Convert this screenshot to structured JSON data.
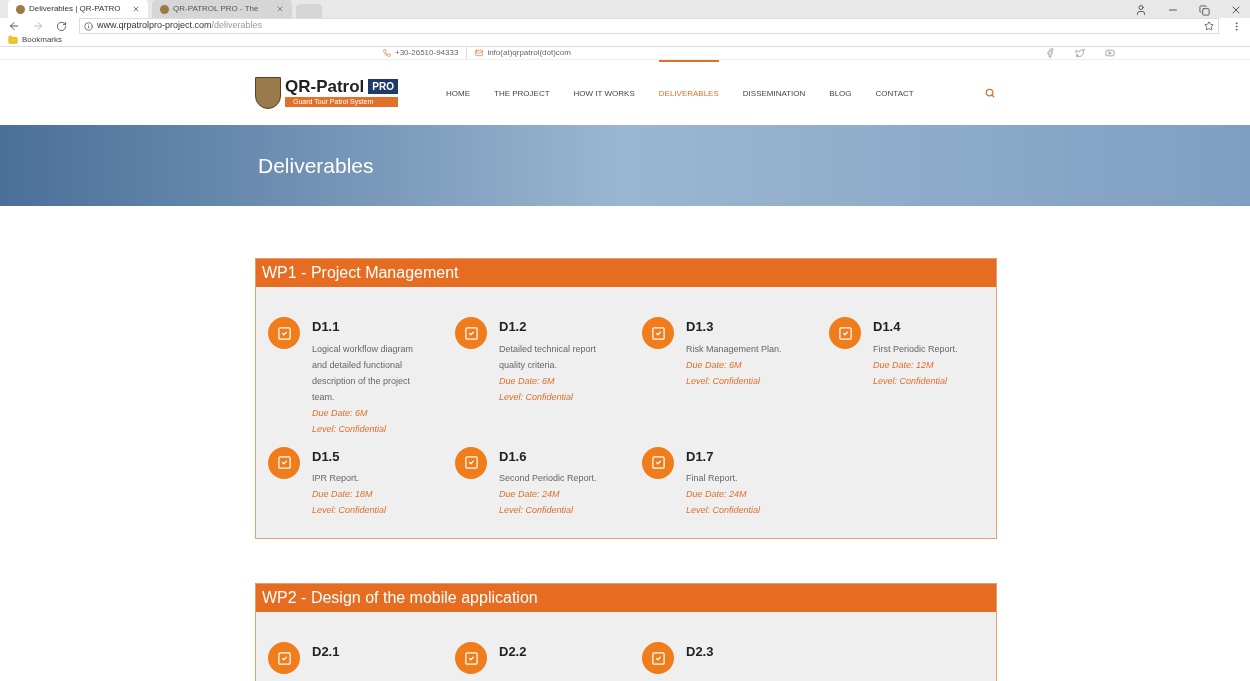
{
  "browser": {
    "tabs": [
      {
        "title": "Deliverables | QR-PATRO",
        "selected": true
      },
      {
        "title": "QR-PATROL PRO - The",
        "selected": false
      }
    ],
    "url_host": "www.qrpatrolpro-project.com",
    "url_path": "/deliverables",
    "bookmarks": "Bookmarks"
  },
  "topbar": {
    "phone": "+30-26510-94333",
    "email": "info(at)qrpatrol(dot)com"
  },
  "logo": {
    "name": "QR-Patrol",
    "badge": "PRO",
    "tagline": "Guard Tour Patrol System"
  },
  "nav": [
    {
      "label": "HOME",
      "selected": false
    },
    {
      "label": "THE PROJECT",
      "selected": false
    },
    {
      "label": "HOW IT WORKS",
      "selected": false
    },
    {
      "label": "DELIVERABLES",
      "selected": true
    },
    {
      "label": "DISSEMINATION",
      "selected": false
    },
    {
      "label": "BLOG",
      "selected": false
    },
    {
      "label": "CONTACT",
      "selected": false
    }
  ],
  "banner": {
    "title": "Deliverables"
  },
  "work_packages": [
    {
      "title": "WP1 - Project Management",
      "items": [
        {
          "code": "D1.1",
          "description": "Logical workflow diagram and detailed functional description of the project team.",
          "due": "Due Date: 6M",
          "level": "Level: Confidential"
        },
        {
          "code": "D1.2",
          "description": "Detailed technical report quality criteria.",
          "due": "Due Date: 6M",
          "level": "Level: Confidential"
        },
        {
          "code": "D1.3",
          "description": "Risk Management Plan.",
          "due": "Due Date: 6M",
          "level": "Level: Confidential"
        },
        {
          "code": "D1.4",
          "description": "First Periodic Report.",
          "due": "Due Date: 12M",
          "level": "Level: Confidential"
        },
        {
          "code": "D1.5",
          "description": "IPR Report.",
          "due": "Due Date: 18M",
          "level": "Level: Confidential"
        },
        {
          "code": "D1.6",
          "description": "Second Periodic Report.",
          "due": "Due Date: 24M",
          "level": "Level: Confidential"
        },
        {
          "code": "D1.7",
          "description": "Final Report.",
          "due": "Due Date: 24M",
          "level": "Level: Confidential"
        }
      ]
    },
    {
      "title": "WP2 - Design of the mobile application",
      "items": [
        {
          "code": "D2.1"
        },
        {
          "code": "D2.2"
        },
        {
          "code": "D2.3"
        }
      ]
    }
  ]
}
